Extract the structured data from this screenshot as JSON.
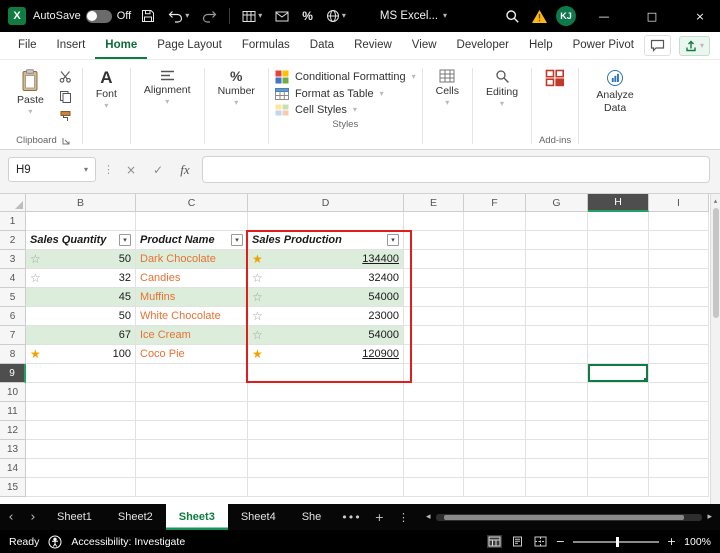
{
  "titlebar": {
    "autosave_label": "AutoSave",
    "autosave_state": "Off",
    "doc_title": "MS Excel...",
    "avatar_initials": "KJ"
  },
  "menu": {
    "items": [
      "File",
      "Insert",
      "Home",
      "Page Layout",
      "Formulas",
      "Data",
      "Review",
      "View",
      "Developer",
      "Help",
      "Power Pivot"
    ],
    "active": "Home"
  },
  "ribbon": {
    "paste_label": "Paste",
    "clipboard_group_label": "Clipboard",
    "font_label": "Font",
    "alignment_label": "Alignment",
    "number_label": "Number",
    "conditional_formatting_label": "Conditional Formatting",
    "format_as_table_label": "Format as Table",
    "cell_styles_label": "Cell Styles",
    "styles_group_label": "Styles",
    "cells_label": "Cells",
    "editing_label": "Editing",
    "addins_group_label": "Add-ins",
    "analyze_data_label": "Analyze Data"
  },
  "formula_bar": {
    "name_box": "H9",
    "fx_label": "fx",
    "formula_value": ""
  },
  "grid": {
    "column_letters": [
      "B",
      "C",
      "D",
      "E",
      "F",
      "G",
      "H",
      "I"
    ],
    "selected_column": "H",
    "row_count": 15,
    "selected_row": 9,
    "table": {
      "header_row": 2,
      "headers": [
        {
          "col": "B",
          "text": "Sales Quantity"
        },
        {
          "col": "C",
          "text": "Product Name"
        },
        {
          "col": "D",
          "text": "Sales Production"
        }
      ],
      "rows": [
        {
          "row": 3,
          "qty": "50",
          "qty_star": "outline",
          "product": "Dark Chocolate",
          "production": "134400",
          "prod_star": "gold",
          "underline": true,
          "banded": true
        },
        {
          "row": 4,
          "qty": "32",
          "qty_star": "outline",
          "product": "Candies",
          "production": "32400",
          "prod_star": "outline",
          "underline": false,
          "banded": false
        },
        {
          "row": 5,
          "qty": "45",
          "qty_star": "none",
          "product": "Muffins",
          "production": "54000",
          "prod_star": "outline",
          "underline": false,
          "banded": true
        },
        {
          "row": 6,
          "qty": "50",
          "qty_star": "none",
          "product": "White Chocolate",
          "production": "23000",
          "prod_star": "outline",
          "underline": false,
          "banded": false
        },
        {
          "row": 7,
          "qty": "67",
          "qty_star": "none",
          "product": "Ice Cream",
          "production": "54000",
          "prod_star": "outline",
          "underline": false,
          "banded": true
        },
        {
          "row": 8,
          "qty": "100",
          "qty_star": "gold",
          "product": "Coco Pie",
          "production": "120900",
          "prod_star": "gold",
          "underline": true,
          "banded": false
        }
      ]
    }
  },
  "sheet_bar": {
    "tabs": [
      "Sheet1",
      "Sheet2",
      "Sheet3",
      "Sheet4",
      "She"
    ],
    "active_tab": "Sheet3"
  },
  "status_bar": {
    "mode": "Ready",
    "accessibility": "Accessibility: Investigate",
    "zoom_level": "100%"
  },
  "colors": {
    "accent_green": "#107C41",
    "band_green": "#DCEDDC",
    "product_orange": "#E97132",
    "annotation_red": "#E01E1E",
    "star_gold": "#F0A202"
  },
  "icons": {
    "chevron_down": "▾",
    "dots_vertical": "⋮",
    "more_tabs": "•••",
    "tab_nav_left": "‹",
    "tab_nav_right": "›",
    "scroll_left": "◂",
    "scroll_right": "▸",
    "scroll_up": "▴",
    "minimize": "—",
    "maximize": "□",
    "close": "×",
    "cancel": "×",
    "check": "✓",
    "star_filled": "★",
    "star_outline": "☆",
    "filter": "▾",
    "new_sheet": "+",
    "zoom_out": "−",
    "zoom_in": "+",
    "percent": "%"
  }
}
